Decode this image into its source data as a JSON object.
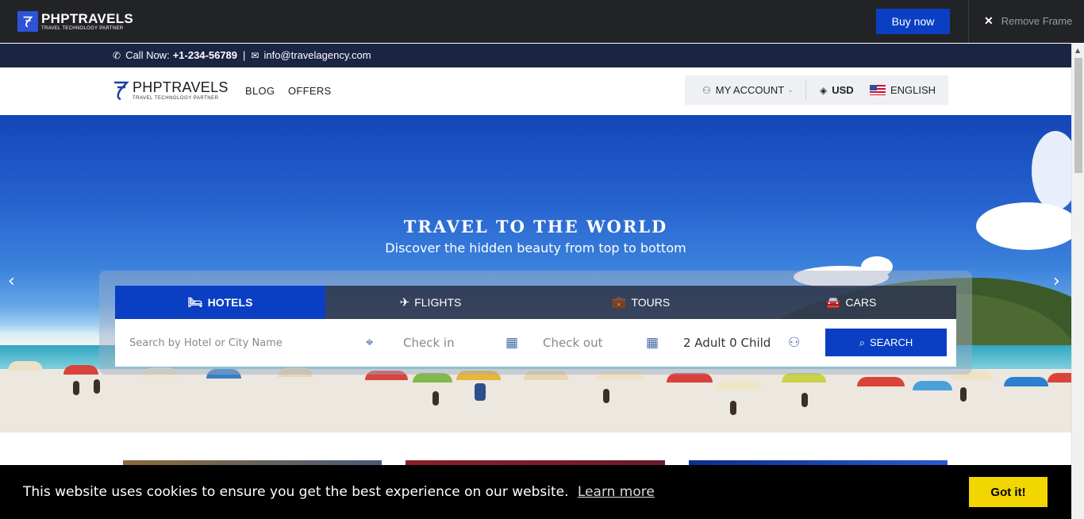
{
  "frame": {
    "logo_name": "PHPTRAVELS",
    "logo_tagline": "TRAVEL TECHNOLOGY PARTNER",
    "buy_label": "Buy now",
    "remove_label": "Remove Frame"
  },
  "contact": {
    "call_label": "Call Now:",
    "phone": "+1-234-56789",
    "separator": "|",
    "email": "info@travelagency.com"
  },
  "header": {
    "logo_name": "PHPTRAVELS",
    "logo_tagline": "TRAVEL TECHNOLOGY PARTNER",
    "nav": [
      {
        "label": "BLOG"
      },
      {
        "label": "OFFERS"
      }
    ],
    "account_label": "MY ACCOUNT",
    "currency": "USD",
    "language": "ENGLISH"
  },
  "hero": {
    "title": "TRAVEL TO THE WORLD",
    "subtitle": "Discover the hidden beauty from top to bottom"
  },
  "search": {
    "tabs": [
      {
        "label": "HOTELS",
        "active": true
      },
      {
        "label": "FLIGHTS",
        "active": false
      },
      {
        "label": "TOURS",
        "active": false
      },
      {
        "label": "CARS",
        "active": false
      }
    ],
    "location_placeholder": "Search by Hotel or City Name",
    "checkin_placeholder": "Check in",
    "checkout_placeholder": "Check out",
    "guests": "2 Adult 0 Child",
    "button_label": "SEARCH"
  },
  "cookie": {
    "message": "This website uses cookies to ensure you get the best experience on our website.",
    "learn_more": "Learn more",
    "accept_label": "Got it!"
  },
  "colors": {
    "primary": "#0a3fc4",
    "frame_bg": "#222326",
    "contact_bg": "#1a2443",
    "cookie_button": "#f1d600"
  },
  "icons": [
    "logo-icon",
    "close-icon",
    "phone-icon",
    "envelope-icon",
    "user-icon",
    "chevron-down-icon",
    "tag-icon",
    "flag-icon",
    "bed-icon",
    "plane-icon",
    "suitcase-icon",
    "car-icon",
    "map-pin-icon",
    "calendar-icon",
    "search-icon",
    "arrow-left-icon",
    "arrow-right-icon"
  ]
}
